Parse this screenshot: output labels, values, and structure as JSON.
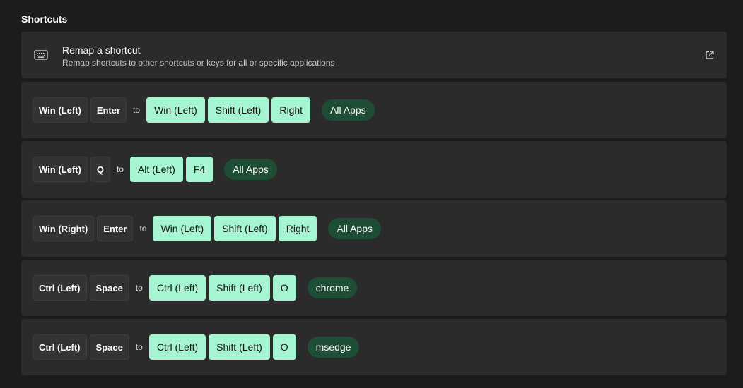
{
  "section": {
    "title": "Shortcuts"
  },
  "remap": {
    "title": "Remap a shortcut",
    "description": "Remap shortcuts to other shortcuts or keys for all or specific applications"
  },
  "to_label": "to",
  "rows": [
    {
      "source": [
        "Win (Left)",
        "Enter"
      ],
      "target": [
        "Win (Left)",
        "Shift (Left)",
        "Right"
      ],
      "app": "All Apps"
    },
    {
      "source": [
        "Win (Left)",
        "Q"
      ],
      "target": [
        "Alt (Left)",
        "F4"
      ],
      "app": "All Apps"
    },
    {
      "source": [
        "Win (Right)",
        "Enter"
      ],
      "target": [
        "Win (Left)",
        "Shift (Left)",
        "Right"
      ],
      "app": "All Apps"
    },
    {
      "source": [
        "Ctrl (Left)",
        "Space"
      ],
      "target": [
        "Ctrl (Left)",
        "Shift (Left)",
        "O"
      ],
      "app": "chrome"
    },
    {
      "source": [
        "Ctrl (Left)",
        "Space"
      ],
      "target": [
        "Ctrl (Left)",
        "Shift (Left)",
        "O"
      ],
      "app": "msedge"
    }
  ],
  "icons": {
    "remap": "keyboard-icon",
    "open": "external-link-icon"
  },
  "colors": {
    "background": "#1c1c1c",
    "card": "#2b2b2b",
    "source_key": "#333333",
    "target_key": "#a6f5d2",
    "app_pill": "#1e4d36"
  }
}
